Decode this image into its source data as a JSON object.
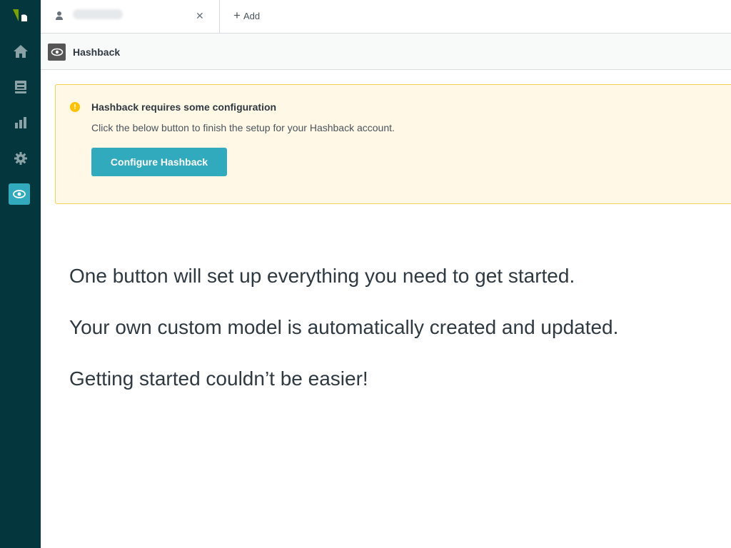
{
  "sidebar": {
    "items": [
      {
        "icon": "zendesk-logo-icon"
      },
      {
        "icon": "home-icon"
      },
      {
        "icon": "views-icon"
      },
      {
        "icon": "reporting-icon"
      },
      {
        "icon": "gear-icon"
      },
      {
        "icon": "hashback-app-icon"
      }
    ],
    "colors": {
      "background": "#03363d",
      "active": "#30aabc",
      "icon": "#8aa2a5"
    }
  },
  "tabbar": {
    "tab_title": "",
    "add_label": "Add"
  },
  "app": {
    "name": "Hashback"
  },
  "notice": {
    "title": "Hashback requires some configuration",
    "body": "Click the below button to finish the setup for your Hashback account.",
    "button_label": "Configure Hashback",
    "colors": {
      "background": "#fff8e6",
      "border": "#f1d256",
      "icon": "#ffc200"
    }
  },
  "marketing": {
    "line1": "One button will set up everything you need to get started.",
    "line2": "Your own custom model is automatically created and updated.",
    "line3": "Getting started couldn’t be easier!"
  }
}
